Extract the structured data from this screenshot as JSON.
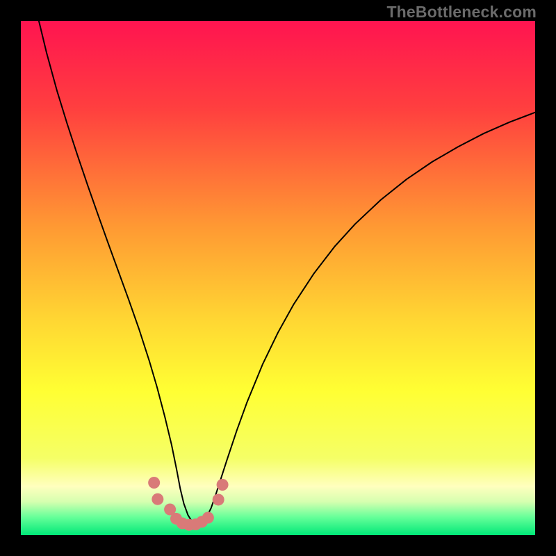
{
  "watermark": "TheBottleneck.com",
  "chart_data": {
    "type": "line",
    "title": "",
    "xlabel": "",
    "ylabel": "",
    "xlim": [
      0,
      100
    ],
    "ylim": [
      0,
      100
    ],
    "grid": false,
    "legend": false,
    "background_gradient_stops": [
      {
        "offset": 0.0,
        "color": "#ff1450"
      },
      {
        "offset": 0.17,
        "color": "#ff3f3f"
      },
      {
        "offset": 0.4,
        "color": "#ff9933"
      },
      {
        "offset": 0.58,
        "color": "#ffd633"
      },
      {
        "offset": 0.72,
        "color": "#ffff33"
      },
      {
        "offset": 0.85,
        "color": "#f5ff66"
      },
      {
        "offset": 0.905,
        "color": "#ffffbe"
      },
      {
        "offset": 0.935,
        "color": "#d6ffb0"
      },
      {
        "offset": 0.965,
        "color": "#66ff99"
      },
      {
        "offset": 1.0,
        "color": "#00e878"
      }
    ],
    "series": [
      {
        "name": "bottleneck-curve",
        "stroke": "#000000",
        "stroke_width": 2,
        "x": [
          3.5,
          5,
          7,
          9,
          11,
          13,
          15,
          17,
          19,
          21,
          23,
          25,
          26.5,
          28,
          29.3,
          30.3,
          31,
          31.7,
          32.5,
          33.3,
          34,
          35,
          36,
          37,
          38,
          40,
          42,
          44,
          47,
          50,
          53,
          57,
          61,
          65,
          70,
          75,
          80,
          85,
          90,
          95,
          100
        ],
        "y": [
          100,
          93.8,
          86.5,
          80,
          73.9,
          68,
          62.3,
          56.7,
          51.2,
          45.7,
          40,
          33.8,
          28.7,
          23,
          17.6,
          12.7,
          9,
          6.1,
          3.9,
          2.6,
          2.2,
          2.4,
          3.3,
          5.3,
          8.2,
          14.4,
          20.4,
          25.9,
          33.2,
          39.4,
          44.8,
          50.9,
          56.1,
          60.5,
          65.2,
          69.2,
          72.6,
          75.5,
          78.1,
          80.3,
          82.2
        ]
      },
      {
        "name": "low-band-markers",
        "type": "scatter",
        "stroke": "#d97a78",
        "fill": "#d97a78",
        "radius": 8.5,
        "x": [
          25.9,
          26.6,
          29.0,
          30.2,
          31.4,
          32.7,
          34.0,
          35.2,
          36.4,
          38.4,
          39.2
        ],
        "y": [
          10.2,
          7.0,
          5.0,
          3.2,
          2.3,
          2.0,
          2.1,
          2.6,
          3.4,
          6.9,
          9.8
        ]
      }
    ]
  }
}
